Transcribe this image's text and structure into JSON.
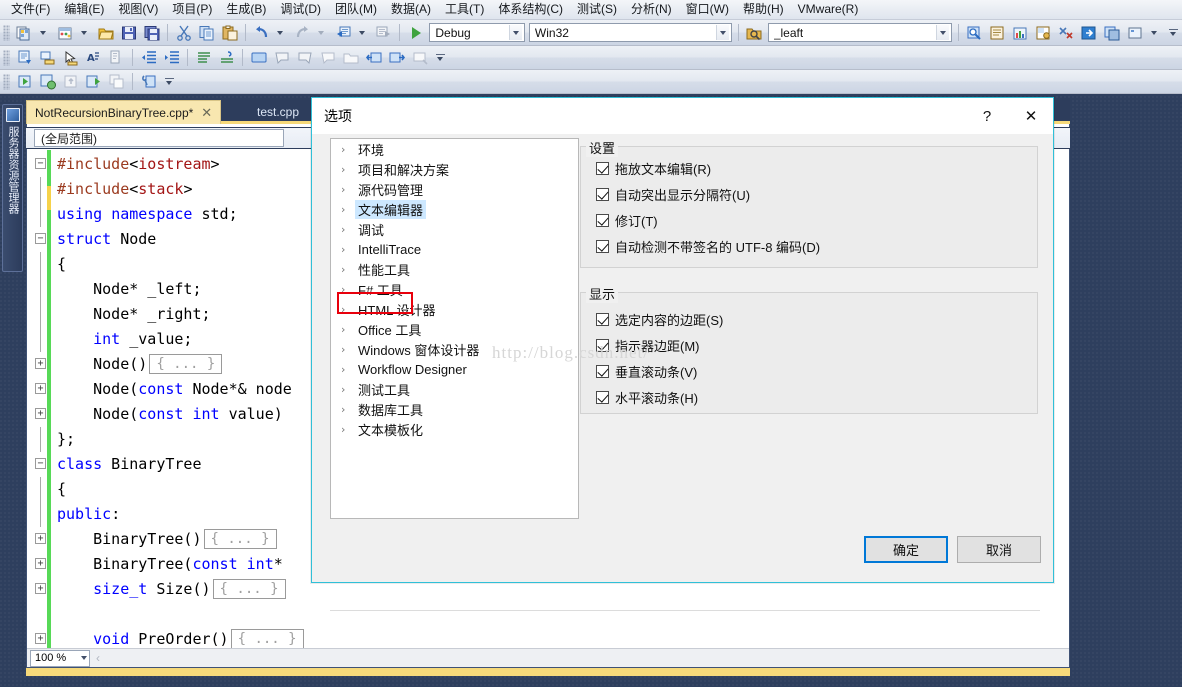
{
  "menu": {
    "items": [
      "文件(F)",
      "编辑(E)",
      "视图(V)",
      "项目(P)",
      "生成(B)",
      "调试(D)",
      "团队(M)",
      "数据(A)",
      "工具(T)",
      "体系结构(C)",
      "测试(S)",
      "分析(N)",
      "窗口(W)",
      "帮助(H)",
      "VMware(R)"
    ]
  },
  "toolbar": {
    "config_combo": "Debug",
    "platform_combo": "Win32",
    "find_combo": "_leaft",
    "icons": [
      "new-project-icon",
      "new-item-icon",
      "open-file-icon",
      "save-icon",
      "save-all-icon",
      "cut-icon",
      "copy-icon",
      "paste-icon",
      "undo-icon",
      "redo-icon",
      "navigate-backward-icon",
      "navigate-forward-icon",
      "start-debug-icon",
      "find-in-files-icon",
      "properties-window-icon",
      "toolbox-icon",
      "solution-explorer-icon",
      "object-browser-icon",
      "error-list-icon"
    ]
  },
  "dock": {
    "server_explorer_label": "服务器资源管理器"
  },
  "editor": {
    "tabs": [
      {
        "label": "NotRecursionBinaryTree.cpp*",
        "active": true,
        "close": "✕"
      },
      {
        "label": "test.cpp",
        "active": false
      }
    ],
    "scope_combo": "(全局范围)",
    "zoom": "100 %",
    "code_lines": [
      {
        "fold": "−",
        "text": "#include<iostream>",
        "indent": 0
      },
      {
        "fold": "",
        "text": "#include<stack>",
        "indent": 0
      },
      {
        "fold": "",
        "text": "using namespace std;",
        "indent": 0
      },
      {
        "fold": "−",
        "text": "struct Node",
        "indent": 0
      },
      {
        "fold": "",
        "text": "{",
        "indent": 0
      },
      {
        "fold": "",
        "text": "    Node* _left;",
        "indent": 0
      },
      {
        "fold": "",
        "text": "    Node* _right;",
        "indent": 0
      },
      {
        "fold": "",
        "text": "    int _value;",
        "indent": 0
      },
      {
        "fold": "+",
        "text": "    Node()",
        "collapsed": "{ ... }",
        "indent": 0
      },
      {
        "fold": "+",
        "text": "    Node(const Node*& node",
        "indent": 0
      },
      {
        "fold": "+",
        "text": "    Node(const int value)",
        "indent": 0
      },
      {
        "fold": "",
        "text": "};",
        "indent": 0
      },
      {
        "fold": "−",
        "text": "class BinaryTree",
        "indent": 0
      },
      {
        "fold": "",
        "text": "{",
        "indent": 0
      },
      {
        "fold": "",
        "text": "public:",
        "indent": 0
      },
      {
        "fold": "+",
        "text": "    BinaryTree()",
        "collapsed": "{ ... }",
        "indent": 0
      },
      {
        "fold": "+",
        "text": "    BinaryTree(const int*",
        "indent": 0
      },
      {
        "fold": "+",
        "text": "    size_t Size()",
        "collapsed": "{ ... }",
        "indent": 0
      },
      {
        "fold": "",
        "text": "",
        "indent": 0
      },
      {
        "fold": "+",
        "text": "    void PreOrder()",
        "collapsed": "{ ... }",
        "indent": 0
      },
      {
        "fold": "",
        "text": "",
        "indent": 0
      }
    ]
  },
  "dialog": {
    "title": "选项",
    "help_button": "?",
    "close_button": "✕",
    "tree_items": [
      {
        "label": "环境",
        "selected": false
      },
      {
        "label": "项目和解决方案",
        "selected": false
      },
      {
        "label": "源代码管理",
        "selected": false
      },
      {
        "label": "文本编辑器",
        "selected": true
      },
      {
        "label": "调试",
        "selected": false
      },
      {
        "label": "IntelliTrace",
        "selected": false
      },
      {
        "label": "性能工具",
        "selected": false
      },
      {
        "label": "F# 工具",
        "selected": false
      },
      {
        "label": "HTML 设计器",
        "selected": false
      },
      {
        "label": "Office 工具",
        "selected": false
      },
      {
        "label": "Windows 窗体设计器",
        "selected": false
      },
      {
        "label": "Workflow Designer",
        "selected": false
      },
      {
        "label": "测试工具",
        "selected": false
      },
      {
        "label": "数据库工具",
        "selected": false
      },
      {
        "label": "文本模板化",
        "selected": false
      }
    ],
    "tree_chevron": "›",
    "groups": [
      {
        "title": "设置",
        "options": [
          {
            "label": "拖放文本编辑(R)",
            "checked": true
          },
          {
            "label": "自动突出显示分隔符(U)",
            "checked": true
          },
          {
            "label": "修订(T)",
            "checked": true
          },
          {
            "label": "自动检测不带签名的 UTF-8 编码(D)",
            "checked": true
          }
        ]
      },
      {
        "title": "显示",
        "options": [
          {
            "label": "选定内容的边距(S)",
            "checked": true
          },
          {
            "label": "指示器边距(M)",
            "checked": true
          },
          {
            "label": "垂直滚动条(V)",
            "checked": true
          },
          {
            "label": "水平滚动条(H)",
            "checked": true
          }
        ]
      }
    ],
    "ok_button": "确定",
    "cancel_button": "取消",
    "watermark": "http://blog.csdn.net/",
    "highlight_color": "#e8000c",
    "accent_color": "#0078d7"
  }
}
